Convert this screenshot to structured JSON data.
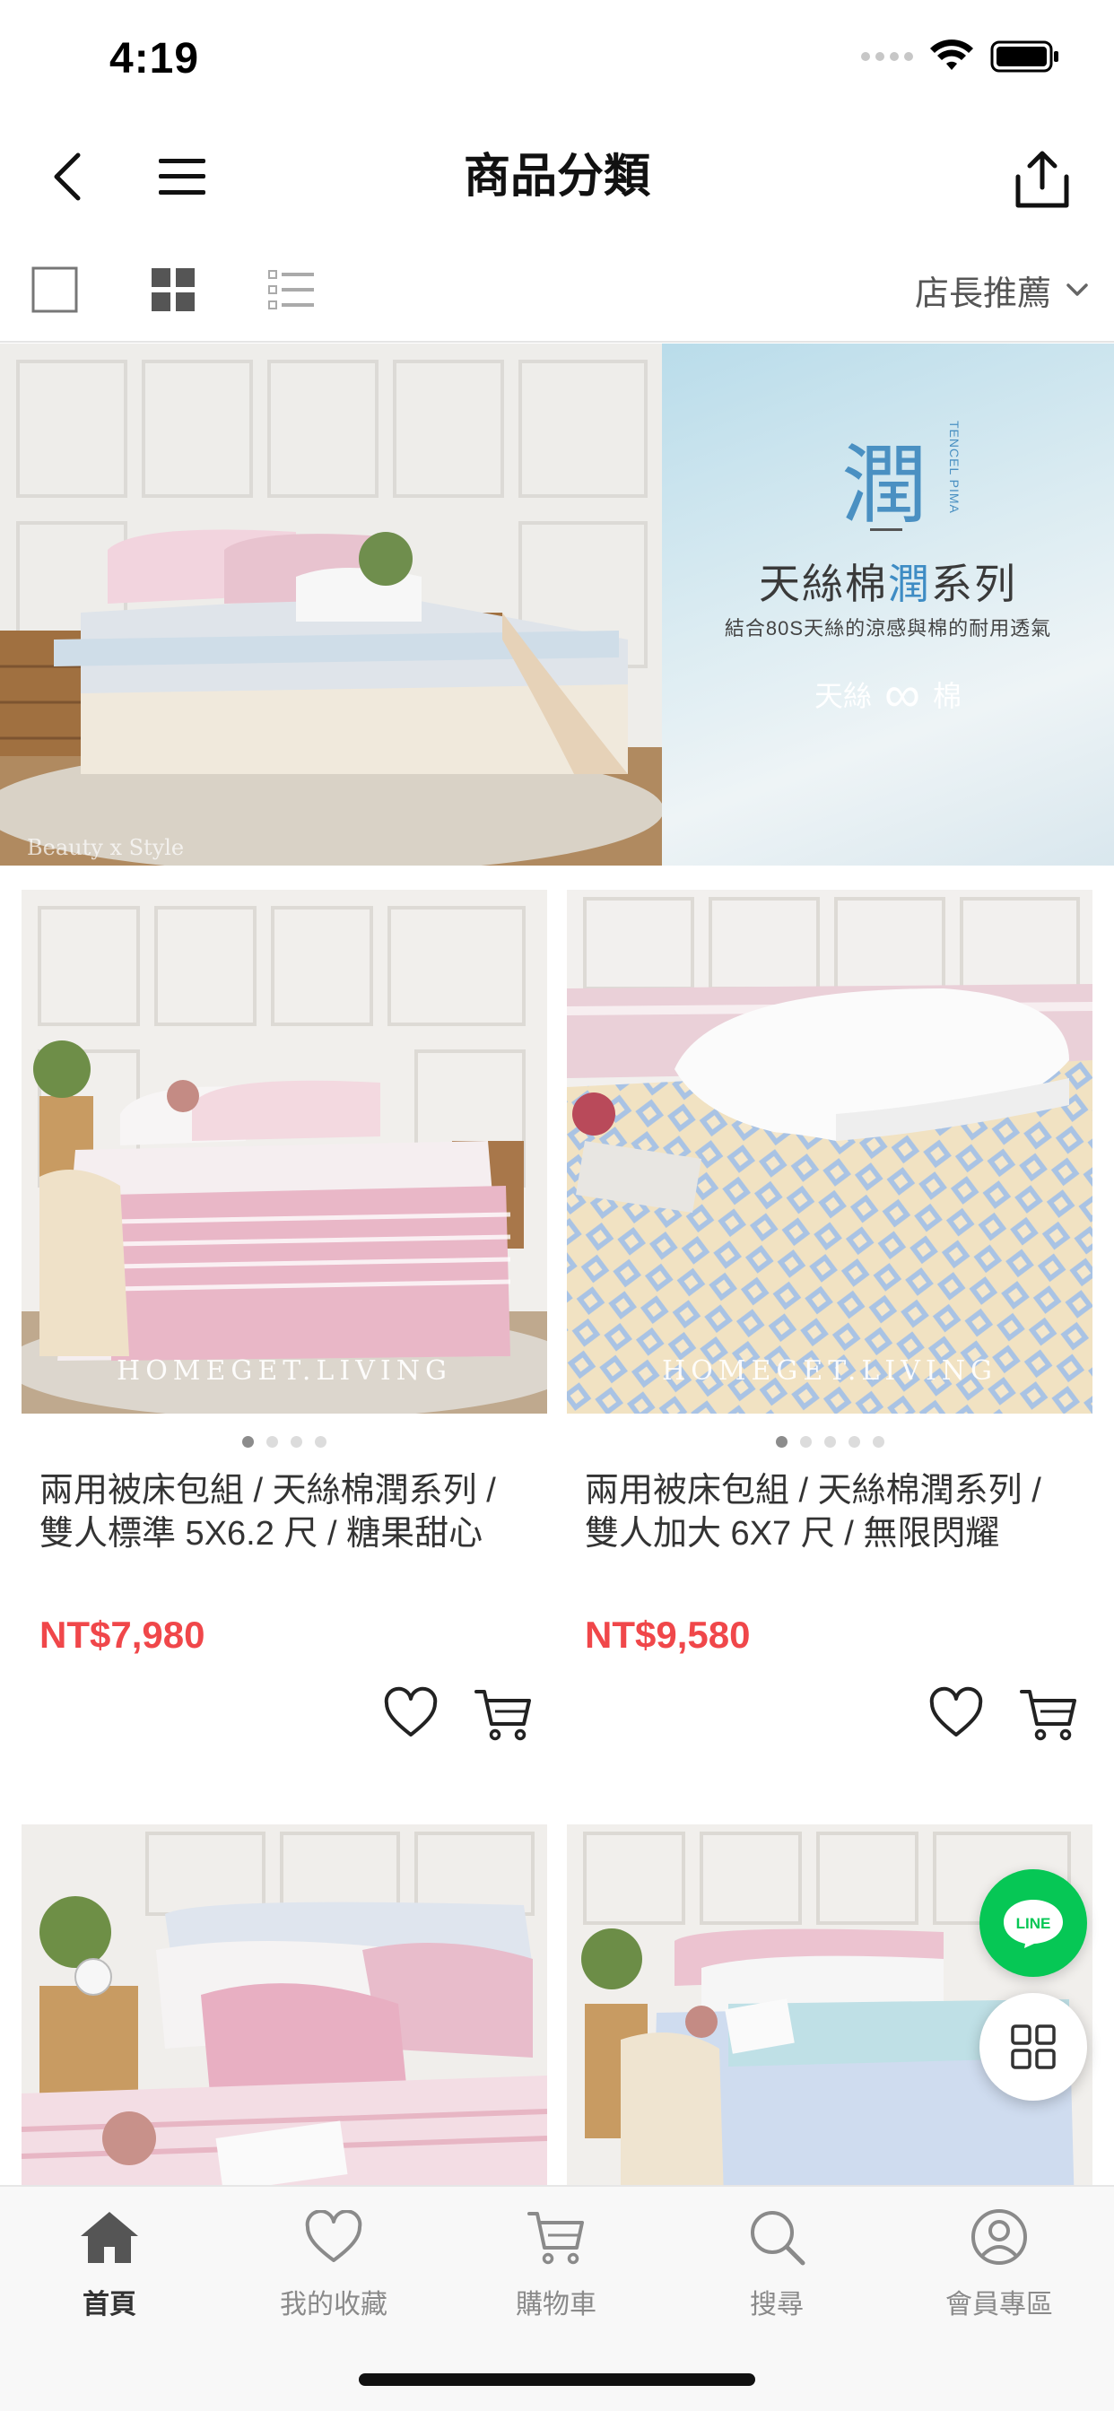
{
  "status_bar": {
    "time": "4:19"
  },
  "nav": {
    "title": "商品分類"
  },
  "toolbar": {
    "sort_selected": "店長推薦"
  },
  "banner": {
    "glyph": "潤",
    "glyph_sub": "TENCEL PIMA",
    "heading_prefix": "天絲棉",
    "heading_highlight": "潤",
    "heading_suffix": "系列",
    "subheading": "結合80S天絲的涼感與棉的耐用透氣",
    "brand_left": "天絲",
    "brand_symbol": "∞",
    "brand_right": "棉",
    "photo_watermark": "Beauty x Style"
  },
  "products": [
    {
      "name": "兩用被床包組 / 天絲棉潤系列 / 雙人標準 5X6.2 尺 / 糖果甜心",
      "price": "NT$7,980",
      "watermark": "HOMEGET.LIVING",
      "image_count": 4,
      "active_image": 1,
      "palette": "pink"
    },
    {
      "name": "兩用被床包組 / 天絲棉潤系列 / 雙人加大 6X7 尺 / 無限閃耀",
      "price": "NT$9,580",
      "watermark": "HOMEGET.LIVING",
      "image_count": 5,
      "active_image": 1,
      "palette": "blue"
    }
  ],
  "fab": {
    "line_label": "LINE"
  },
  "tabs": [
    {
      "label": "首頁",
      "icon": "home-icon",
      "active": true
    },
    {
      "label": "我的收藏",
      "icon": "heart-icon",
      "active": false
    },
    {
      "label": "購物車",
      "icon": "cart-icon",
      "active": false
    },
    {
      "label": "搜尋",
      "icon": "search-icon",
      "active": false
    },
    {
      "label": "會員專區",
      "icon": "user-icon",
      "active": false
    }
  ],
  "colors": {
    "price": "#f0474a",
    "line_green": "#06c755",
    "banner_accent": "#3e8cc4"
  }
}
